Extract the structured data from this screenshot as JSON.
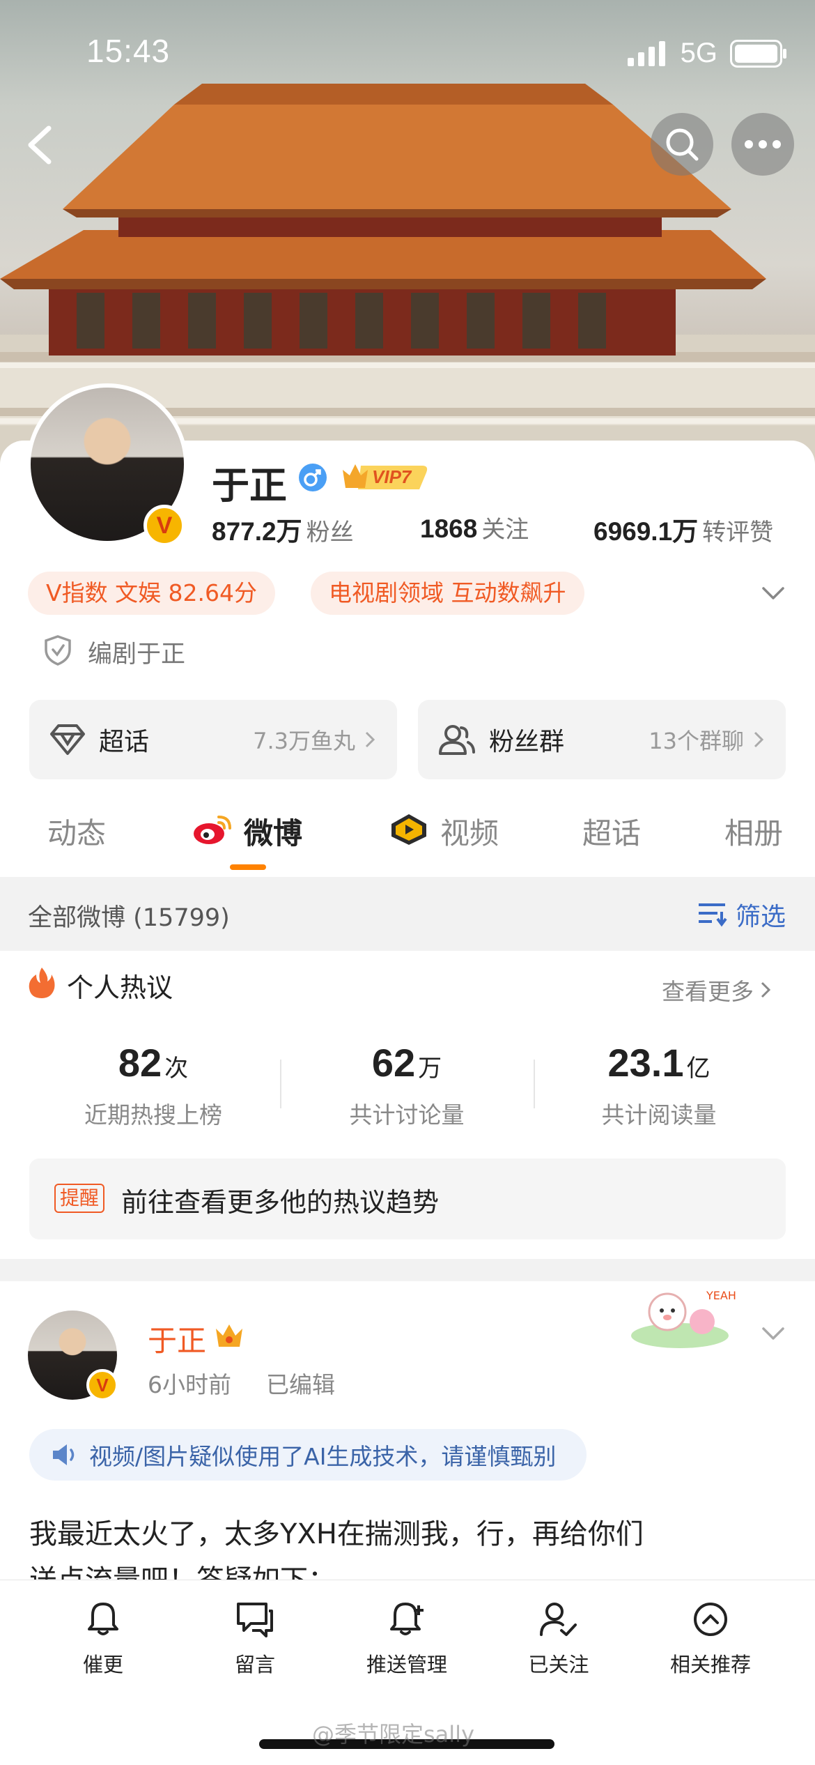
{
  "status_bar": {
    "time": "15:43",
    "network": "5G"
  },
  "profile": {
    "name": "于正",
    "vip_label": "VIP7",
    "stats": [
      {
        "value": "877.2万",
        "label": "粉丝"
      },
      {
        "value": "1868",
        "label": "关注"
      },
      {
        "value": "6969.1万",
        "label": "转评赞"
      }
    ],
    "tags": [
      "V指数 文娱 82.64分",
      "电视剧领域 互动数飙升"
    ],
    "certification": "编剧于正"
  },
  "entries": [
    {
      "title": "超话",
      "meta": "7.3万鱼丸"
    },
    {
      "title": "粉丝群",
      "meta": "13个群聊"
    }
  ],
  "tabs": [
    "动态",
    "微博",
    "视频",
    "超话",
    "相册"
  ],
  "filter": {
    "label": "全部微博 (15799)",
    "button": "筛选"
  },
  "hot": {
    "title": "个人热议",
    "more": "查看更多",
    "metrics": [
      {
        "value": "82",
        "unit": "次",
        "label": "近期热搜上榜"
      },
      {
        "value": "62",
        "unit": "万",
        "label": "共计讨论量"
      },
      {
        "value": "23.1",
        "unit": "亿",
        "label": "共计阅读量"
      }
    ],
    "reminder_tag": "提醒",
    "reminder_text": "前往查看更多他的热议趋势"
  },
  "post": {
    "author": "于正",
    "time": "6小时前",
    "edited": "已编辑",
    "ai_notice": "视频/图片疑似使用了AI生成技术，请谨慎甄别",
    "text_line1": "我最近太火了，太多YXH在揣测我，行，再给你们",
    "text_line2": "送点流量吧！答疑如下："
  },
  "bottom_bar": [
    "催更",
    "留言",
    "推送管理",
    "已关注",
    "相关推荐"
  ],
  "watermark": "@季节限定sally"
}
